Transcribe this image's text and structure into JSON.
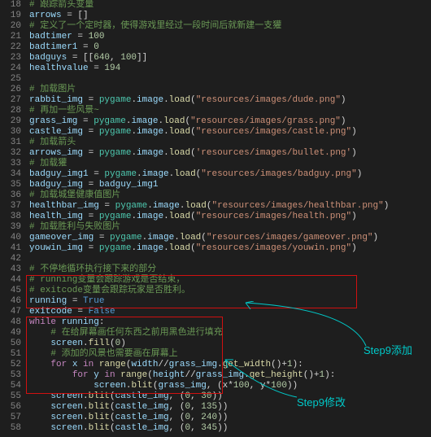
{
  "gutter_start": 18,
  "annotations": {
    "add": "Step9添加",
    "modify": "Step9修改"
  },
  "lines": [
    [
      [
        "# 跟踪箭头变量",
        "comment"
      ]
    ],
    [
      [
        "arrows ",
        "var"
      ],
      [
        "= []",
        "op"
      ]
    ],
    [
      [
        "# 定义了一个定时器，使得游戏里经过一段时间后就新建一支獾",
        "comment"
      ]
    ],
    [
      [
        "badtimer ",
        "var"
      ],
      [
        "= ",
        "op"
      ],
      [
        "100",
        "num"
      ]
    ],
    [
      [
        "badtimer1 ",
        "var"
      ],
      [
        "= ",
        "op"
      ],
      [
        "0",
        "num"
      ]
    ],
    [
      [
        "badguys ",
        "var"
      ],
      [
        "= [[",
        "op"
      ],
      [
        "640",
        "num"
      ],
      [
        ", ",
        "op"
      ],
      [
        "100",
        "num"
      ],
      [
        "]]",
        "op"
      ]
    ],
    [
      [
        "healthvalue ",
        "var"
      ],
      [
        "= ",
        "op"
      ],
      [
        "194",
        "num"
      ]
    ],
    [
      [
        "",
        "op"
      ]
    ],
    [
      [
        "# 加载图片",
        "comment"
      ]
    ],
    [
      [
        "rabbit_img ",
        "var"
      ],
      [
        "= ",
        "op"
      ],
      [
        "pygame",
        "type"
      ],
      [
        ".",
        "op"
      ],
      [
        "image",
        "var"
      ],
      [
        ".",
        "op"
      ],
      [
        "load",
        "func"
      ],
      [
        "(",
        "op"
      ],
      [
        "\"resources/images/dude.png\"",
        "string"
      ],
      [
        ")",
        "op"
      ]
    ],
    [
      [
        "# 再加一些风景~",
        "comment"
      ]
    ],
    [
      [
        "grass_img ",
        "var"
      ],
      [
        "= ",
        "op"
      ],
      [
        "pygame",
        "type"
      ],
      [
        ".",
        "op"
      ],
      [
        "image",
        "var"
      ],
      [
        ".",
        "op"
      ],
      [
        "load",
        "func"
      ],
      [
        "(",
        "op"
      ],
      [
        "\"resources/images/grass.png\"",
        "string"
      ],
      [
        ")",
        "op"
      ]
    ],
    [
      [
        "castle_img ",
        "var"
      ],
      [
        "= ",
        "op"
      ],
      [
        "pygame",
        "type"
      ],
      [
        ".",
        "op"
      ],
      [
        "image",
        "var"
      ],
      [
        ".",
        "op"
      ],
      [
        "load",
        "func"
      ],
      [
        "(",
        "op"
      ],
      [
        "\"resources/images/castle.png\"",
        "string"
      ],
      [
        ")",
        "op"
      ]
    ],
    [
      [
        "# 加载箭头",
        "comment"
      ]
    ],
    [
      [
        "arrows_img ",
        "var"
      ],
      [
        "= ",
        "op"
      ],
      [
        "pygame",
        "type"
      ],
      [
        ".",
        "op"
      ],
      [
        "image",
        "var"
      ],
      [
        ".",
        "op"
      ],
      [
        "load",
        "func"
      ],
      [
        "(",
        "op"
      ],
      [
        "'resources/images/bullet.png'",
        "string"
      ],
      [
        ")",
        "op"
      ]
    ],
    [
      [
        "# 加载獾",
        "comment"
      ]
    ],
    [
      [
        "badguy_img1 ",
        "var"
      ],
      [
        "= ",
        "op"
      ],
      [
        "pygame",
        "type"
      ],
      [
        ".",
        "op"
      ],
      [
        "image",
        "var"
      ],
      [
        ".",
        "op"
      ],
      [
        "load",
        "func"
      ],
      [
        "(",
        "op"
      ],
      [
        "\"resources/images/badguy.png\"",
        "string"
      ],
      [
        ")",
        "op"
      ]
    ],
    [
      [
        "badguy_img ",
        "var"
      ],
      [
        "= ",
        "op"
      ],
      [
        "badguy_img1",
        "var"
      ]
    ],
    [
      [
        "# 加载城堡健康值图片",
        "comment"
      ]
    ],
    [
      [
        "healthbar_img ",
        "var"
      ],
      [
        "= ",
        "op"
      ],
      [
        "pygame",
        "type"
      ],
      [
        ".",
        "op"
      ],
      [
        "image",
        "var"
      ],
      [
        ".",
        "op"
      ],
      [
        "load",
        "func"
      ],
      [
        "(",
        "op"
      ],
      [
        "\"resources/images/healthbar.png\"",
        "string"
      ],
      [
        ")",
        "op"
      ]
    ],
    [
      [
        "health_img ",
        "var"
      ],
      [
        "= ",
        "op"
      ],
      [
        "pygame",
        "type"
      ],
      [
        ".",
        "op"
      ],
      [
        "image",
        "var"
      ],
      [
        ".",
        "op"
      ],
      [
        "load",
        "func"
      ],
      [
        "(",
        "op"
      ],
      [
        "\"resources/images/health.png\"",
        "string"
      ],
      [
        ")",
        "op"
      ]
    ],
    [
      [
        "# 加载胜利与失败图片",
        "comment"
      ]
    ],
    [
      [
        "gameover_img ",
        "var"
      ],
      [
        "= ",
        "op"
      ],
      [
        "pygame",
        "type"
      ],
      [
        ".",
        "op"
      ],
      [
        "image",
        "var"
      ],
      [
        ".",
        "op"
      ],
      [
        "load",
        "func"
      ],
      [
        "(",
        "op"
      ],
      [
        "\"resources/images/gameover.png\"",
        "string"
      ],
      [
        ")",
        "op"
      ]
    ],
    [
      [
        "youwin_img ",
        "var"
      ],
      [
        "= ",
        "op"
      ],
      [
        "pygame",
        "type"
      ],
      [
        ".",
        "op"
      ],
      [
        "image",
        "var"
      ],
      [
        ".",
        "op"
      ],
      [
        "load",
        "func"
      ],
      [
        "(",
        "op"
      ],
      [
        "\"resources/images/youwin.png\"",
        "string"
      ],
      [
        ")",
        "op"
      ]
    ],
    [
      [
        "",
        "op"
      ]
    ],
    [
      [
        "# 不停地循环执行接下来的部分",
        "comment"
      ]
    ],
    [
      [
        "# running变量会跟踪游戏是否结束，",
        "comment"
      ]
    ],
    [
      [
        "# exitcode变量会跟踪玩家是否胜利。",
        "comment"
      ]
    ],
    [
      [
        "running ",
        "var"
      ],
      [
        "= ",
        "op"
      ],
      [
        "True",
        "keyword"
      ]
    ],
    [
      [
        "exitcode ",
        "var"
      ],
      [
        "= ",
        "op"
      ],
      [
        "False",
        "keyword"
      ]
    ],
    [
      [
        "while ",
        "keyword2"
      ],
      [
        "running",
        "var"
      ],
      [
        ":",
        "op"
      ]
    ],
    [
      [
        "    ",
        "op"
      ],
      [
        "# 在给屏幕画任何东西之前用黑色进行填充",
        "comment"
      ]
    ],
    [
      [
        "    ",
        "op"
      ],
      [
        "screen",
        "var"
      ],
      [
        ".",
        "op"
      ],
      [
        "fill",
        "func"
      ],
      [
        "(",
        "op"
      ],
      [
        "0",
        "num"
      ],
      [
        ")",
        "op"
      ]
    ],
    [
      [
        "    ",
        "op"
      ],
      [
        "# 添加的风景也需要画在屏幕上",
        "comment"
      ]
    ],
    [
      [
        "    ",
        "op"
      ],
      [
        "for ",
        "keyword2"
      ],
      [
        "x ",
        "var"
      ],
      [
        "in ",
        "keyword2"
      ],
      [
        "range",
        "func"
      ],
      [
        "(",
        "op"
      ],
      [
        "width",
        "var"
      ],
      [
        "//",
        "op"
      ],
      [
        "grass_img",
        "var"
      ],
      [
        ".",
        "op"
      ],
      [
        "get_width",
        "func"
      ],
      [
        "()",
        "op"
      ],
      [
        "+",
        "op"
      ],
      [
        "1",
        "num"
      ],
      [
        "):",
        "op"
      ]
    ],
    [
      [
        "        ",
        "op"
      ],
      [
        "for ",
        "keyword2"
      ],
      [
        "y ",
        "var"
      ],
      [
        "in ",
        "keyword2"
      ],
      [
        "range",
        "func"
      ],
      [
        "(",
        "op"
      ],
      [
        "height",
        "var"
      ],
      [
        "//",
        "op"
      ],
      [
        "grass_img",
        "var"
      ],
      [
        ".",
        "op"
      ],
      [
        "get_height",
        "func"
      ],
      [
        "()",
        "op"
      ],
      [
        "+",
        "op"
      ],
      [
        "1",
        "num"
      ],
      [
        "):",
        "op"
      ]
    ],
    [
      [
        "            ",
        "op"
      ],
      [
        "screen",
        "var"
      ],
      [
        ".",
        "op"
      ],
      [
        "blit",
        "func"
      ],
      [
        "(",
        "op"
      ],
      [
        "grass_img",
        "var"
      ],
      [
        ", (x",
        "op"
      ],
      [
        "*",
        "op"
      ],
      [
        "100",
        "num"
      ],
      [
        ", y",
        "op"
      ],
      [
        "*",
        "op"
      ],
      [
        "100",
        "num"
      ],
      [
        "))",
        "op"
      ]
    ],
    [
      [
        "    ",
        "op"
      ],
      [
        "screen",
        "var"
      ],
      [
        ".",
        "op"
      ],
      [
        "blit",
        "func"
      ],
      [
        "(",
        "op"
      ],
      [
        "castle_img",
        "var"
      ],
      [
        ", (",
        "op"
      ],
      [
        "0",
        "num"
      ],
      [
        ", ",
        "op"
      ],
      [
        "30",
        "num"
      ],
      [
        "))",
        "op"
      ]
    ],
    [
      [
        "    ",
        "op"
      ],
      [
        "screen",
        "var"
      ],
      [
        ".",
        "op"
      ],
      [
        "blit",
        "func"
      ],
      [
        "(",
        "op"
      ],
      [
        "castle_img",
        "var"
      ],
      [
        ", (",
        "op"
      ],
      [
        "0",
        "num"
      ],
      [
        ", ",
        "op"
      ],
      [
        "135",
        "num"
      ],
      [
        "))",
        "op"
      ]
    ],
    [
      [
        "    ",
        "op"
      ],
      [
        "screen",
        "var"
      ],
      [
        ".",
        "op"
      ],
      [
        "blit",
        "func"
      ],
      [
        "(",
        "op"
      ],
      [
        "castle_img",
        "var"
      ],
      [
        ", (",
        "op"
      ],
      [
        "0",
        "num"
      ],
      [
        ", ",
        "op"
      ],
      [
        "240",
        "num"
      ],
      [
        "))",
        "op"
      ]
    ],
    [
      [
        "    ",
        "op"
      ],
      [
        "screen",
        "var"
      ],
      [
        ".",
        "op"
      ],
      [
        "blit",
        "func"
      ],
      [
        "(",
        "op"
      ],
      [
        "castle_img",
        "var"
      ],
      [
        ", (",
        "op"
      ],
      [
        "0",
        "num"
      ],
      [
        ", ",
        "op"
      ],
      [
        "345",
        "num"
      ],
      [
        "))",
        "op"
      ]
    ]
  ]
}
